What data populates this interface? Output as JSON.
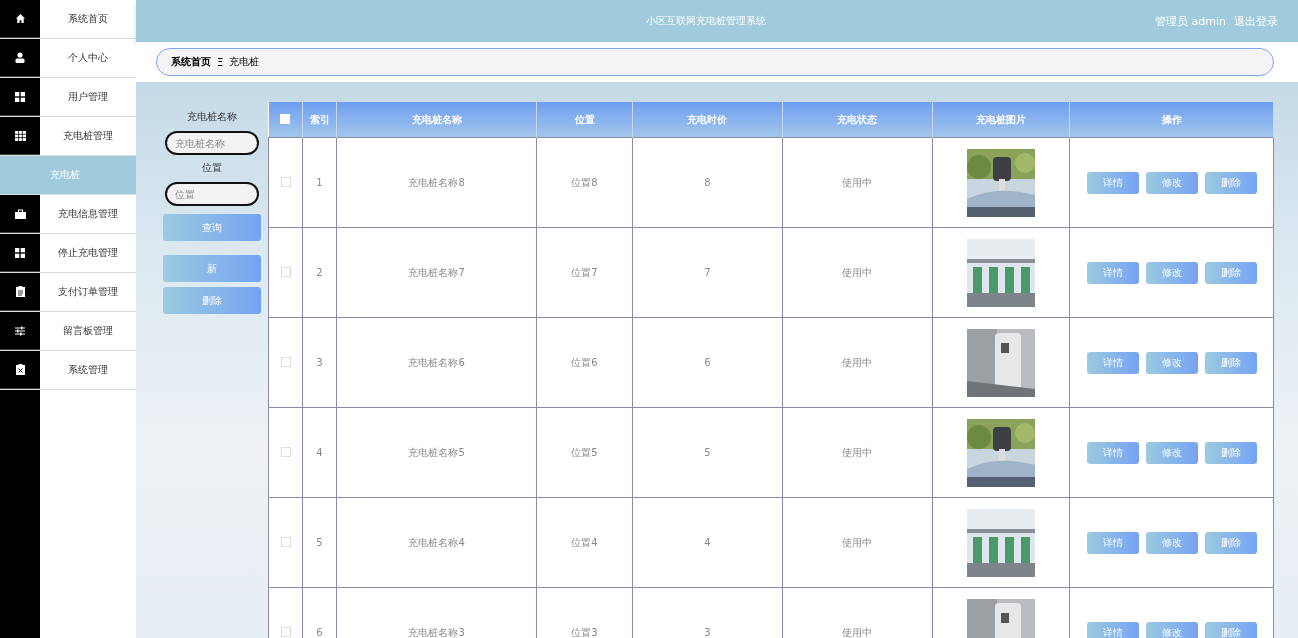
{
  "header": {
    "title": "小区互联网充电桩管理系统",
    "user": "管理员 admin",
    "logout": "退出登录"
  },
  "sidebar": {
    "items": [
      {
        "label": "系统首页",
        "selected": false
      },
      {
        "label": "个人中心",
        "selected": false
      },
      {
        "label": "用户管理",
        "selected": false
      },
      {
        "label": "充电桩管理",
        "selected": false
      },
      {
        "label": "充电桩",
        "selected": true
      },
      {
        "label": "充电信息管理",
        "selected": false
      },
      {
        "label": "停止充电管理",
        "selected": false
      },
      {
        "label": "支付订单管理",
        "selected": false
      },
      {
        "label": "留言板管理",
        "selected": false
      },
      {
        "label": "系统管理",
        "selected": false
      }
    ]
  },
  "breadcrumb": {
    "home": "系统首页",
    "separator": "Ξ",
    "current": "充电桩"
  },
  "search": {
    "fields": [
      {
        "label": "充电桩名称",
        "placeholder": "充电桩名称"
      },
      {
        "label": "位置",
        "placeholder": "位置"
      }
    ],
    "query_button": "查询",
    "add_button": "新",
    "delete_button": "删除"
  },
  "table": {
    "select_all_checked": false,
    "columns": [
      "索引",
      "充电桩名称",
      "位置",
      "充电时价",
      "充电状态",
      "充电桩图片",
      "操作"
    ],
    "rows": [
      {
        "index": "1",
        "name": "充电桩名称8",
        "location": "位置8",
        "price": "8",
        "status": "使用中",
        "checked": false,
        "actions": [
          "详情",
          "修改",
          "删除"
        ]
      },
      {
        "index": "2",
        "name": "充电桩名称7",
        "location": "位置7",
        "price": "7",
        "status": "使用中",
        "checked": false,
        "actions": [
          "详情",
          "修改",
          "删除"
        ]
      },
      {
        "index": "3",
        "name": "充电桩名称6",
        "location": "位置6",
        "price": "6",
        "status": "使用中",
        "checked": false,
        "actions": [
          "详情",
          "修改",
          "删除"
        ]
      },
      {
        "index": "4",
        "name": "充电桩名称5",
        "location": "位置5",
        "price": "5",
        "status": "使用中",
        "checked": false,
        "actions": [
          "详情",
          "修改",
          "删除"
        ]
      },
      {
        "index": "5",
        "name": "充电桩名称4",
        "location": "位置4",
        "price": "4",
        "status": "使用中",
        "checked": false,
        "actions": [
          "详情",
          "修改",
          "删除"
        ]
      },
      {
        "index": "6",
        "name": "充电桩名称3",
        "location": "位置3",
        "price": "3",
        "status": "使用中",
        "checked": false,
        "actions": [
          "详情",
          "修改",
          "删除"
        ]
      }
    ]
  }
}
